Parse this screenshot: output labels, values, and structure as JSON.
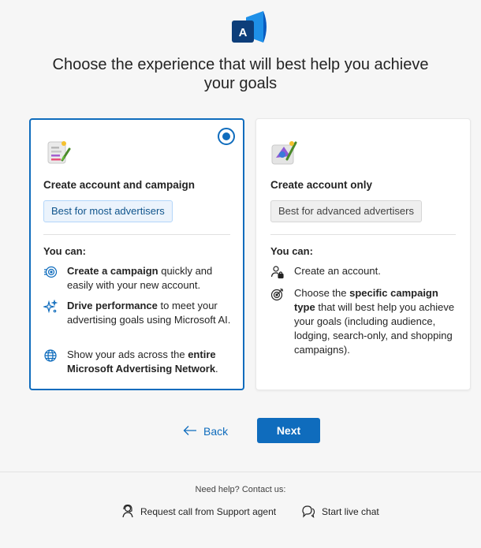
{
  "brand": {
    "logo_letter": "A",
    "accent": "#0f6cbd"
  },
  "heading": {
    "line1": "Choose the experience that will best help you achieve",
    "line2": "your goals"
  },
  "cards": [
    {
      "selected": true,
      "title": "Create account and campaign",
      "badge": "Best for most advertisers",
      "you_can": "You can:",
      "features": [
        {
          "icon": "campaign-target-icon",
          "bold1": "Create a campaign",
          "text1": " quickly and easily with your new account.",
          "bold2": "",
          "text2": ""
        },
        {
          "icon": "sparkle-icon",
          "bold1": "Drive performance",
          "text1": " to meet your advertising goals using Microsoft AI.",
          "bold2": "",
          "text2": ""
        },
        {
          "icon": "globe-icon",
          "bold1": "",
          "text1": "Show your ads across the ",
          "bold2": "entire Microsoft Advertising Network",
          "text2": "."
        }
      ]
    },
    {
      "selected": false,
      "title": "Create account only",
      "badge": "Best for advanced advertisers",
      "you_can": "You can:",
      "features": [
        {
          "icon": "person-lock-icon",
          "bold1": "",
          "text1": "Create an account.",
          "bold2": "",
          "text2": ""
        },
        {
          "icon": "target-arrow-icon",
          "bold1": "",
          "text1": "Choose the ",
          "bold2": "specific campaign type",
          "text2": " that will best help you achieve your goals (including audience, lodging, search-only, and shopping campaigns)."
        }
      ]
    }
  ],
  "nav": {
    "back_label": "Back",
    "next_label": "Next"
  },
  "footer": {
    "help_text": "Need help? Contact us:",
    "request_call": "Request call from Support agent",
    "live_chat": "Start live chat"
  }
}
